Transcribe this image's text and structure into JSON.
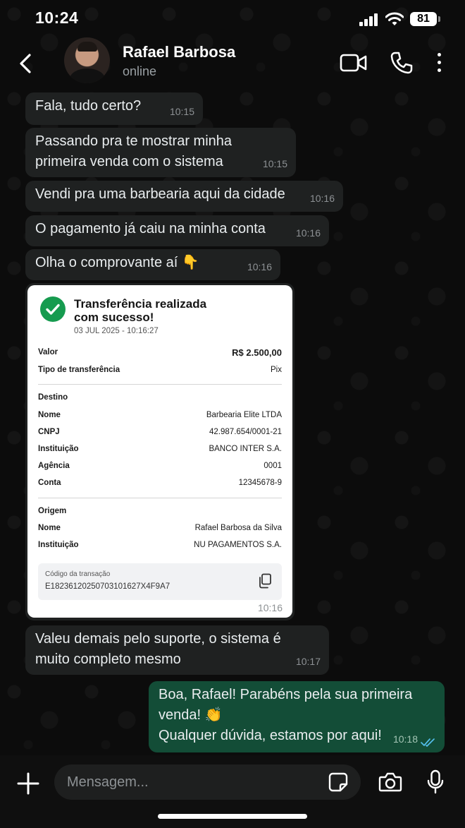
{
  "status_bar": {
    "time": "10:24",
    "battery": "81"
  },
  "contact": {
    "name": "Rafael Barbosa",
    "status": "online"
  },
  "messages": [
    {
      "text": "Fala, tudo certo?",
      "time": "10:15"
    },
    {
      "text": "Passando pra te mostrar minha\nprimeira venda com o sistema",
      "time": "10:15"
    },
    {
      "text": "Vendi pra uma barbearia aqui da cidade",
      "time": "10:16"
    },
    {
      "text": "O pagamento já caiu na minha conta",
      "time": "10:16"
    },
    {
      "text": "Olha o comprovante aí 👇",
      "time": "10:16"
    },
    {
      "text": "Valeu demais pelo suporte, o sistema é\nmuito completo mesmo",
      "time": "10:17"
    },
    {
      "text": "Boa, Rafael! Parabéns pela sua primeira\nvenda! 👏\nQualquer dúvida, estamos por aqui!",
      "time": "10:18"
    }
  ],
  "receipt": {
    "title": "Transferência realizada com sucesso!",
    "date": "03 JUL 2025 - 10:16:27",
    "valor_label": "Valor",
    "valor": "R$ 2.500,00",
    "tipo_label": "Tipo de transferência",
    "tipo": "Pix",
    "destino_section": "Destino",
    "destino_nome_label": "Nome",
    "destino_nome": "Barbearia Elite LTDA",
    "cnpj_label": "CNPJ",
    "cnpj": "42.987.654/0001-21",
    "destino_instituicao_label": "Instituição",
    "destino_instituicao": "BANCO INTER S.A.",
    "agencia_label": "Agência",
    "agencia": "0001",
    "conta_label": "Conta",
    "conta": "12345678-9",
    "origem_section": "Origem",
    "origem_nome_label": "Nome",
    "origem_nome": "Rafael Barbosa da Silva",
    "origem_instituicao_label": "Instituição",
    "origem_instituicao": "NU PAGAMENTOS S.A.",
    "codigo_label": "Código da transação",
    "codigo": "E18236120250703101627X4F9A7",
    "time": "10:16"
  },
  "composer": {
    "placeholder": "Mensagem..."
  },
  "colors": {
    "outgoing_bubble": "#134d37",
    "incoming_bubble": "#1f2121",
    "success": "#169b4f",
    "read_ticks": "#53bdeb"
  }
}
